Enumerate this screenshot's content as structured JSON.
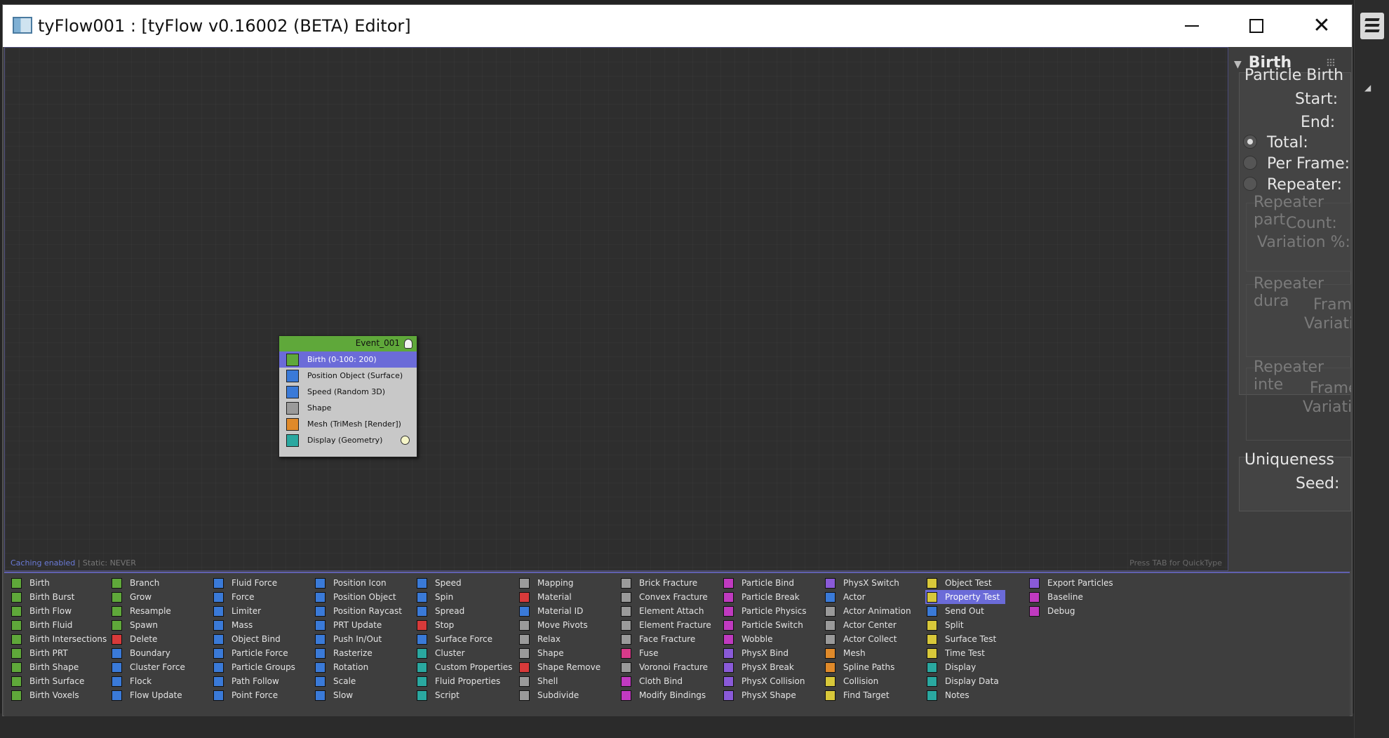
{
  "window": {
    "title": "tyFlow001 : [tyFlow v0.16002 (BETA) Editor]",
    "controls": {
      "minimize": "—",
      "maximize": "☐",
      "close": "✕"
    }
  },
  "canvas": {
    "status_caching": "Caching enabled",
    "status_sep": " | Static: NEVER",
    "status_right": "Press TAB for QuickType"
  },
  "event": {
    "name": "Event_001",
    "operators": [
      {
        "label": "Birth (0-100: 200)",
        "icon": "birth-icon",
        "color": "#5fa83a",
        "selected": true
      },
      {
        "label": "Position Object (Surface)",
        "icon": "position-object-icon",
        "color": "#3a7ad8",
        "selected": false
      },
      {
        "label": "Speed (Random 3D)",
        "icon": "speed-icon",
        "color": "#3a7ad8",
        "selected": false
      },
      {
        "label": "Shape",
        "icon": "shape-icon",
        "color": "#9a9a9a",
        "selected": false
      },
      {
        "label": "Mesh (TriMesh [Render])",
        "icon": "mesh-icon",
        "color": "#e08a2a",
        "selected": false
      },
      {
        "label": "Display (Geometry)",
        "icon": "display-icon",
        "color": "#2aa8a0",
        "selected": false
      }
    ]
  },
  "rollout": {
    "title": "Birth",
    "group_birth": "Particle Birth",
    "start": "Start:",
    "end": "End:",
    "total": "Total:",
    "per_frame": "Per Frame:",
    "repeater": "Repeater:",
    "repeater_part": "Repeater part",
    "count": "Count:",
    "variation_pct": "Variation %:",
    "repeater_dur": "Repeater dura",
    "frames1": "Fram",
    "variation1": "Variati",
    "repeater_int": "Repeater inte",
    "frames2": "Frame",
    "variation2": "Variatio",
    "group_unique": "Uniqueness",
    "seed": "Seed:"
  },
  "palette": {
    "columns": [
      [
        {
          "label": "Birth",
          "color": "#5fa83a"
        },
        {
          "label": "Birth Burst",
          "color": "#5fa83a"
        },
        {
          "label": "Birth Flow",
          "color": "#5fa83a"
        },
        {
          "label": "Birth Fluid",
          "color": "#5fa83a"
        },
        {
          "label": "Birth Intersections",
          "color": "#5fa83a"
        },
        {
          "label": "Birth PRT",
          "color": "#5fa83a"
        },
        {
          "label": "Birth Shape",
          "color": "#5fa83a"
        },
        {
          "label": "Birth Surface",
          "color": "#5fa83a"
        },
        {
          "label": "Birth Voxels",
          "color": "#5fa83a"
        }
      ],
      [
        {
          "label": "Branch",
          "color": "#5fa83a"
        },
        {
          "label": "Grow",
          "color": "#5fa83a"
        },
        {
          "label": "Resample",
          "color": "#5fa83a"
        },
        {
          "label": "Spawn",
          "color": "#5fa83a"
        },
        {
          "label": "Delete",
          "color": "#d83a3a"
        },
        {
          "label": "Boundary",
          "color": "#3a7ad8"
        },
        {
          "label": "Cluster Force",
          "color": "#3a7ad8"
        },
        {
          "label": "Flock",
          "color": "#3a7ad8"
        },
        {
          "label": "Flow Update",
          "color": "#3a7ad8"
        }
      ],
      [
        {
          "label": "Fluid Force",
          "color": "#3a7ad8"
        },
        {
          "label": "Force",
          "color": "#3a7ad8"
        },
        {
          "label": "Limiter",
          "color": "#3a7ad8"
        },
        {
          "label": "Mass",
          "color": "#3a7ad8"
        },
        {
          "label": "Object Bind",
          "color": "#3a7ad8"
        },
        {
          "label": "Particle Force",
          "color": "#3a7ad8"
        },
        {
          "label": "Particle Groups",
          "color": "#3a7ad8"
        },
        {
          "label": "Path Follow",
          "color": "#3a7ad8"
        },
        {
          "label": "Point Force",
          "color": "#3a7ad8"
        }
      ],
      [
        {
          "label": "Position Icon",
          "color": "#3a7ad8"
        },
        {
          "label": "Position Object",
          "color": "#3a7ad8"
        },
        {
          "label": "Position Raycast",
          "color": "#3a7ad8"
        },
        {
          "label": "PRT Update",
          "color": "#3a7ad8"
        },
        {
          "label": "Push In/Out",
          "color": "#3a7ad8"
        },
        {
          "label": "Rasterize",
          "color": "#3a7ad8"
        },
        {
          "label": "Rotation",
          "color": "#3a7ad8"
        },
        {
          "label": "Scale",
          "color": "#3a7ad8"
        },
        {
          "label": "Slow",
          "color": "#3a7ad8"
        }
      ],
      [
        {
          "label": "Speed",
          "color": "#3a7ad8"
        },
        {
          "label": "Spin",
          "color": "#3a7ad8"
        },
        {
          "label": "Spread",
          "color": "#3a7ad8"
        },
        {
          "label": "Stop",
          "color": "#d83a3a"
        },
        {
          "label": "Surface Force",
          "color": "#3a7ad8"
        },
        {
          "label": "Cluster",
          "color": "#2aa8a0"
        },
        {
          "label": "Custom Properties",
          "color": "#2aa8a0"
        },
        {
          "label": "Fluid Properties",
          "color": "#2aa8a0"
        },
        {
          "label": "Script",
          "color": "#2aa8a0"
        }
      ],
      [
        {
          "label": "Mapping",
          "color": "#9a9a9a"
        },
        {
          "label": "Material",
          "color": "#d83a3a"
        },
        {
          "label": "Material ID",
          "color": "#3a7ad8"
        },
        {
          "label": "Move Pivots",
          "color": "#9a9a9a"
        },
        {
          "label": "Relax",
          "color": "#9a9a9a"
        },
        {
          "label": "Shape",
          "color": "#9a9a9a"
        },
        {
          "label": "Shape Remove",
          "color": "#d83a3a"
        },
        {
          "label": "Shell",
          "color": "#9a9a9a"
        },
        {
          "label": "Subdivide",
          "color": "#9a9a9a"
        }
      ],
      [
        {
          "label": "Brick Fracture",
          "color": "#9a9a9a"
        },
        {
          "label": "Convex Fracture",
          "color": "#9a9a9a"
        },
        {
          "label": "Element Attach",
          "color": "#9a9a9a"
        },
        {
          "label": "Element Fracture",
          "color": "#9a9a9a"
        },
        {
          "label": "Face Fracture",
          "color": "#9a9a9a"
        },
        {
          "label": "Fuse",
          "color": "#d83a8a"
        },
        {
          "label": "Voronoi Fracture",
          "color": "#9a9a9a"
        },
        {
          "label": "Cloth Bind",
          "color": "#c03ac0"
        },
        {
          "label": "Modify Bindings",
          "color": "#c03ac0"
        }
      ],
      [
        {
          "label": "Particle Bind",
          "color": "#c03ac0"
        },
        {
          "label": "Particle Break",
          "color": "#c03ac0"
        },
        {
          "label": "Particle Physics",
          "color": "#c03ac0"
        },
        {
          "label": "Particle Switch",
          "color": "#c03ac0"
        },
        {
          "label": "Wobble",
          "color": "#c03ac0"
        },
        {
          "label": "PhysX Bind",
          "color": "#8a5ad8"
        },
        {
          "label": "PhysX Break",
          "color": "#8a5ad8"
        },
        {
          "label": "PhysX Collision",
          "color": "#8a5ad8"
        },
        {
          "label": "PhysX Shape",
          "color": "#8a5ad8"
        }
      ],
      [
        {
          "label": "PhysX Switch",
          "color": "#8a5ad8"
        },
        {
          "label": "Actor",
          "color": "#3a7ad8"
        },
        {
          "label": "Actor Animation",
          "color": "#9a9a9a"
        },
        {
          "label": "Actor Center",
          "color": "#9a9a9a"
        },
        {
          "label": "Actor Collect",
          "color": "#9a9a9a"
        },
        {
          "label": "Mesh",
          "color": "#e08a2a"
        },
        {
          "label": "Spline Paths",
          "color": "#e08a2a"
        },
        {
          "label": "Collision",
          "color": "#d8c83a"
        },
        {
          "label": "Find Target",
          "color": "#d8c83a"
        }
      ],
      [
        {
          "label": "Object Test",
          "color": "#d8c83a"
        },
        {
          "label": "Property Test",
          "color": "#d8c83a",
          "selected": true
        },
        {
          "label": "Send Out",
          "color": "#3a7ad8"
        },
        {
          "label": "Split",
          "color": "#d8c83a"
        },
        {
          "label": "Surface Test",
          "color": "#d8c83a"
        },
        {
          "label": "Time Test",
          "color": "#d8c83a"
        },
        {
          "label": "Display",
          "color": "#2aa8a0"
        },
        {
          "label": "Display Data",
          "color": "#2aa8a0"
        },
        {
          "label": "Notes",
          "color": "#2aa8a0"
        }
      ],
      [
        {
          "label": "Export Particles",
          "color": "#8a5ad8"
        },
        {
          "label": "Baseline",
          "color": "#c03ac0"
        },
        {
          "label": "Debug",
          "color": "#c03ac0"
        }
      ]
    ]
  }
}
